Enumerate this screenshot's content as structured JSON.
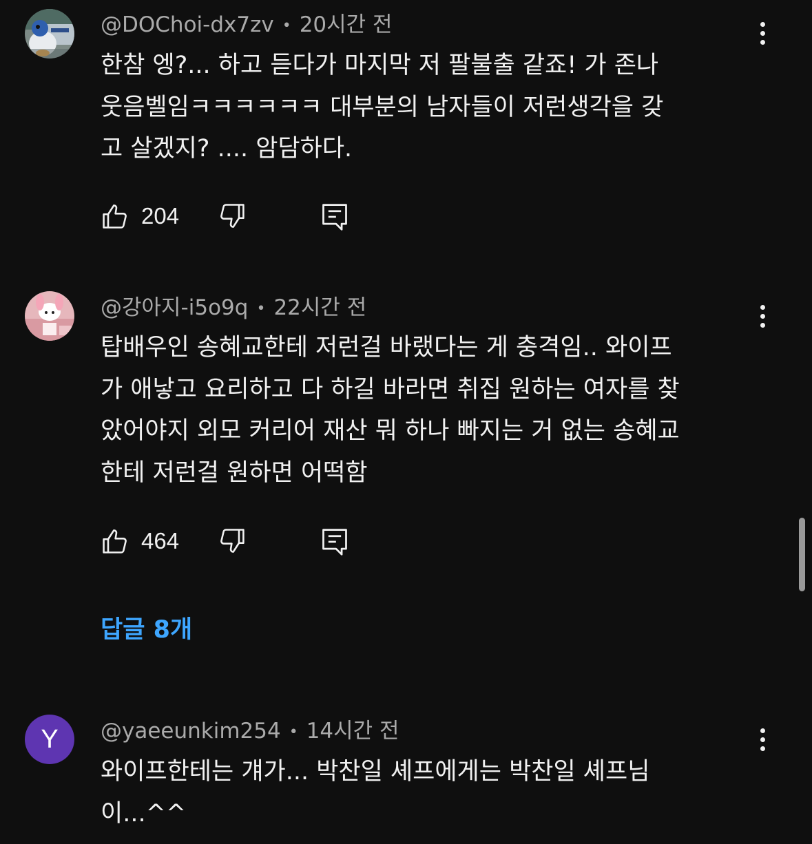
{
  "comments": [
    {
      "author": "@DOChoi-dx7zv",
      "time": "20시간 전",
      "text": "한참 엥?... 하고 듣다가 마지막 저  팔불출 같죠! 가 존나\n웃음벨임ㅋㅋㅋㅋㅋㅋ 대부분의 남자들이 저런생각을 갖\n고 살겠지?  .... 암담하다.",
      "likes": "204",
      "avatar_icon": "duck-photo-avatar"
    },
    {
      "author": "@강아지-i5o9q",
      "time": "22시간 전",
      "text": "탑배우인 송혜교한테 저런걸 바랬다는 게 충격임.. 와이프\n가 애낳고 요리하고 다 하길 바라면 취집 원하는 여자를 찾\n았어야지 외모 커리어 재산 뭐 하나 빠지는 거 없는 송혜교\n한테 저런걸 원하면 어떡함",
      "likes": "464",
      "replies_label": "답글 8개",
      "avatar_icon": "my-melody-photo-avatar"
    },
    {
      "author": "@yaeeunkim254",
      "time": "14시간 전",
      "text": "와이프한테는 걔가... 박찬일 셰프에게는 박찬일 셰프님\n이...^^",
      "avatar_letter": "Y",
      "avatar_color": "#5e35b1"
    }
  ],
  "separator": "•",
  "icons": {
    "like": "thumbs-up-icon",
    "dislike": "thumbs-down-icon",
    "reply": "reply-comment-icon",
    "more": "more-vertical-icon"
  },
  "colors": {
    "background": "#0f0f0f",
    "text": "#f1f1f1",
    "meta": "#aaaaaa",
    "link": "#3ea6ff"
  }
}
